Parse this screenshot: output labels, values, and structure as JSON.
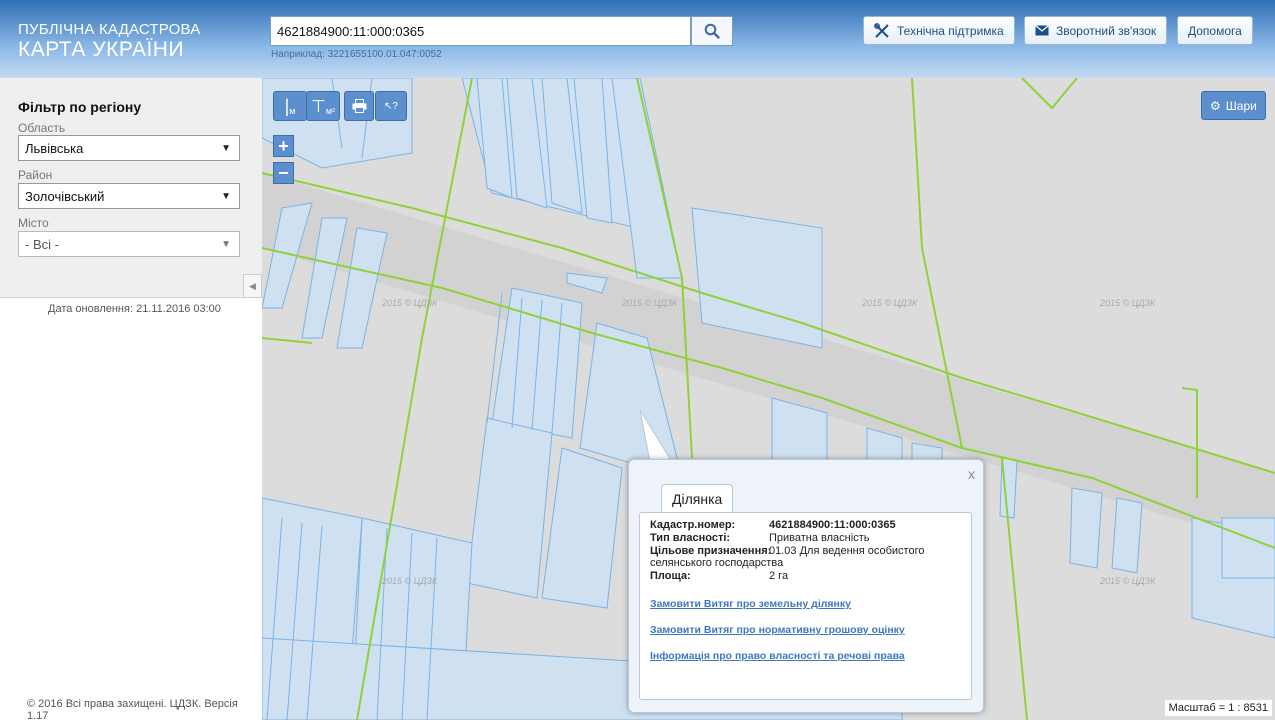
{
  "header": {
    "logo_line1": "ПУБЛІЧНА КАДАСТРОВА",
    "logo_line2": "КАРТА УКРАЇНИ",
    "search_value": "4621884900:11:000:0365",
    "search_hint": "Наприклад: 3221655100.01.047:0052",
    "buttons": {
      "support": "Технічна підтримка",
      "feedback": "Зворотний зв'язок",
      "help": "Допомога"
    }
  },
  "sidebar": {
    "filter_title": "Фільтр по регіону",
    "region_label": "Область",
    "region_value": "Львівська",
    "district_label": "Район",
    "district_value": "Золочівський",
    "city_label": "Місто",
    "city_value": "- Всі -",
    "update_date": "Дата оновлення: 21.11.2016 03:00",
    "copyright": "© 2016 Всі права захищені. ЦДЗК. Версія 1.17"
  },
  "map": {
    "tools": {
      "measure_length": "м",
      "measure_area": "м²",
      "zoom_in": "+",
      "zoom_out": "−"
    },
    "layers_label": "Шари",
    "watermark": "2015 © ЦДЗК",
    "scale": "Масштаб = 1 : 8531"
  },
  "popup": {
    "close": "x",
    "tab": "Ділянка",
    "fields": {
      "cadastre_label": "Кадастр.номер:",
      "cadastre_value": "4621884900:11:000:0365",
      "ownership_label": "Тип власності:",
      "ownership_value": "Приватна власність",
      "purpose_label": "Цільове призначення:",
      "purpose_value": "01.03 Для ведення особистого",
      "purpose_value_cont": "селянського господарства",
      "area_label": "Площа:",
      "area_value": "2 га"
    },
    "links": {
      "extract_land": "Замовити Витяг про земельну ділянку",
      "extract_valuation": "Замовити Витяг про нормативну грошову оцінку",
      "ownership_info": "Інформація про право власності та речові права"
    }
  },
  "colors": {
    "header_blue": "#2f6fb5",
    "button_blue": "#5b8fcd",
    "parcel_fill": "#cfe0f0",
    "parcel_stroke": "#7ab3e8",
    "boundary_green": "#8fd13a",
    "link_blue": "#3e78c2"
  }
}
